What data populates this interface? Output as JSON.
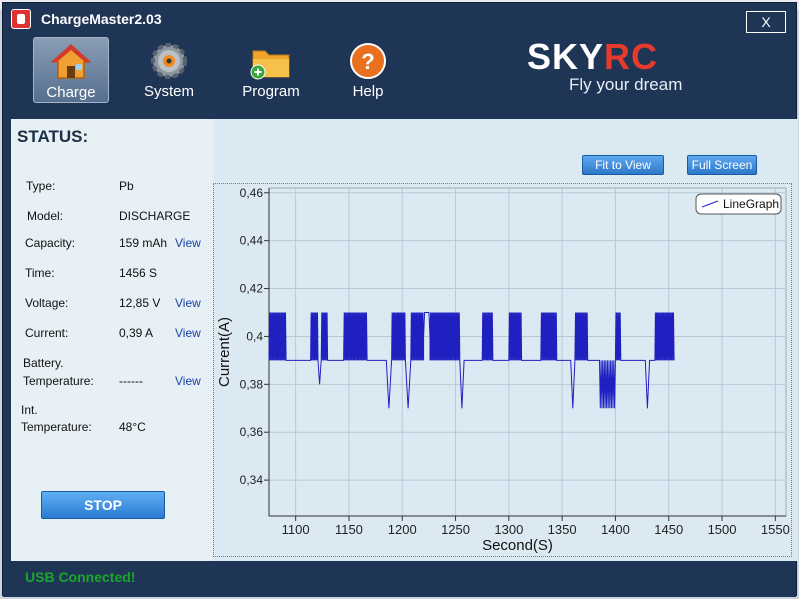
{
  "app": {
    "title": "ChargeMaster2.03",
    "close_label": "X"
  },
  "toolbar": {
    "items": [
      {
        "label": "Charge",
        "icon": "home-icon"
      },
      {
        "label": "System",
        "icon": "gear-icon"
      },
      {
        "label": "Program",
        "icon": "folder-add-icon"
      },
      {
        "label": "Help",
        "icon": "help-icon"
      }
    ]
  },
  "brand": {
    "logo_a": "SKY",
    "logo_b": "RC",
    "tagline": "Fly your dream"
  },
  "status": {
    "title": "STATUS:",
    "type_label": "Type:",
    "type_value": "Pb",
    "model_label": "Model:",
    "model_value": "DISCHARGE",
    "capacity_label": "Capacity:",
    "capacity_value": "159 mAh",
    "time_label": "Time:",
    "time_value": "1456 S",
    "voltage_label": "Voltage:",
    "voltage_value": "12,85 V",
    "current_label": "Current:",
    "current_value": "0,39 A",
    "battery_label_1": "Battery.",
    "battery_label_2": "Temperature:",
    "battery_value": "------",
    "int_label_1": "Int.",
    "int_label_2": "Temperature:",
    "int_value": "48°C",
    "view_label": "View",
    "stop_label": "STOP"
  },
  "chart_controls": {
    "fit_label": "Fit to View",
    "full_label": "Full Screen"
  },
  "footer": {
    "usb_status": "USB  Connected!"
  },
  "colors": {
    "accent": "#2d79c9",
    "window": "#1f3556",
    "usb_ok": "#1aa52b",
    "series": "#2020c0"
  },
  "chart_data": {
    "type": "line",
    "xlabel": "Second(S)",
    "ylabel": "Current(A)",
    "xlim": [
      1075,
      1560
    ],
    "ylim": [
      0.325,
      0.462
    ],
    "xticks": [
      1100,
      1150,
      1200,
      1250,
      1300,
      1350,
      1400,
      1450,
      1500,
      1550
    ],
    "yticks": [
      0.34,
      0.36,
      0.38,
      0.4,
      0.42,
      0.44,
      0.46
    ],
    "ytick_labels": [
      "0,34",
      "0,36",
      "0,38",
      "0,4",
      "0,42",
      "0,44",
      "0,46"
    ],
    "grid": true,
    "legend_position": "top-right",
    "series": [
      {
        "name": "LineGraph",
        "segments": [
          {
            "x0": 1075,
            "x1": 1091,
            "kind": "osc"
          },
          {
            "x0": 1091,
            "x1": 1114,
            "kind": "flat"
          },
          {
            "x0": 1114,
            "x1": 1121,
            "kind": "osc"
          },
          {
            "x0": 1121,
            "x1": 1124,
            "kind": "dip",
            "low": 0.38
          },
          {
            "x0": 1124,
            "x1": 1130,
            "kind": "osc"
          },
          {
            "x0": 1130,
            "x1": 1145,
            "kind": "flat"
          },
          {
            "x0": 1145,
            "x1": 1167,
            "kind": "osc"
          },
          {
            "x0": 1167,
            "x1": 1185,
            "kind": "flat"
          },
          {
            "x0": 1185,
            "x1": 1190,
            "kind": "dip",
            "low": 0.37
          },
          {
            "x0": 1190,
            "x1": 1203,
            "kind": "osc"
          },
          {
            "x0": 1203,
            "x1": 1208,
            "kind": "dip",
            "low": 0.37
          },
          {
            "x0": 1208,
            "x1": 1220,
            "kind": "osc"
          },
          {
            "x0": 1220,
            "x1": 1226,
            "kind": "bump"
          },
          {
            "x0": 1226,
            "x1": 1235,
            "kind": "osc"
          },
          {
            "x0": 1235,
            "x1": 1254,
            "kind": "osc"
          },
          {
            "x0": 1254,
            "x1": 1258,
            "kind": "dip",
            "low": 0.37
          },
          {
            "x0": 1258,
            "x1": 1275,
            "kind": "flat"
          },
          {
            "x0": 1275,
            "x1": 1285,
            "kind": "osc"
          },
          {
            "x0": 1285,
            "x1": 1300,
            "kind": "flat"
          },
          {
            "x0": 1300,
            "x1": 1312,
            "kind": "osc"
          },
          {
            "x0": 1312,
            "x1": 1330,
            "kind": "flat"
          },
          {
            "x0": 1330,
            "x1": 1345,
            "kind": "osc"
          },
          {
            "x0": 1345,
            "x1": 1358,
            "kind": "flat"
          },
          {
            "x0": 1358,
            "x1": 1362,
            "kind": "dip",
            "low": 0.37
          },
          {
            "x0": 1362,
            "x1": 1374,
            "kind": "osc"
          },
          {
            "x0": 1374,
            "x1": 1385,
            "kind": "flat"
          },
          {
            "x0": 1385,
            "x1": 1400,
            "kind": "deeposc"
          },
          {
            "x0": 1400,
            "x1": 1405,
            "kind": "osc"
          },
          {
            "x0": 1405,
            "x1": 1428,
            "kind": "flat"
          },
          {
            "x0": 1428,
            "x1": 1432,
            "kind": "dip",
            "low": 0.37
          },
          {
            "x0": 1432,
            "x1": 1437,
            "kind": "flat"
          },
          {
            "x0": 1437,
            "x1": 1455,
            "kind": "osc"
          }
        ],
        "base_value": 0.39,
        "high_value": 0.41
      }
    ]
  }
}
